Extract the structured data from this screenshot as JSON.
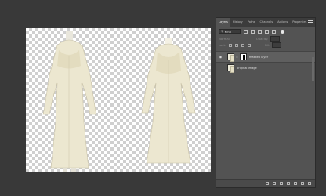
{
  "panel": {
    "tabs": [
      "Layers",
      "History",
      "Paths",
      "Channels",
      "Actions",
      "Properties"
    ],
    "filter_label": "Kind",
    "blend_mode": "Normal",
    "opacity_label": "Opacity:",
    "lock_label": "Lock:",
    "fill_label": "Fill:",
    "layers": [
      {
        "name": "masked layer",
        "visible": "◉",
        "selected": true
      },
      {
        "name": "original image",
        "visible": "",
        "selected": false
      }
    ]
  },
  "icons": {
    "panel_menu": "panel-menu-icon",
    "search": "search-icon",
    "eye": "eye-icon",
    "chain": "chain-link-icon"
  },
  "colors": {
    "app_background": "#393939",
    "panel_background": "#535353",
    "selected_layer": "#5f5f5f",
    "garment": "#ede8d4"
  }
}
